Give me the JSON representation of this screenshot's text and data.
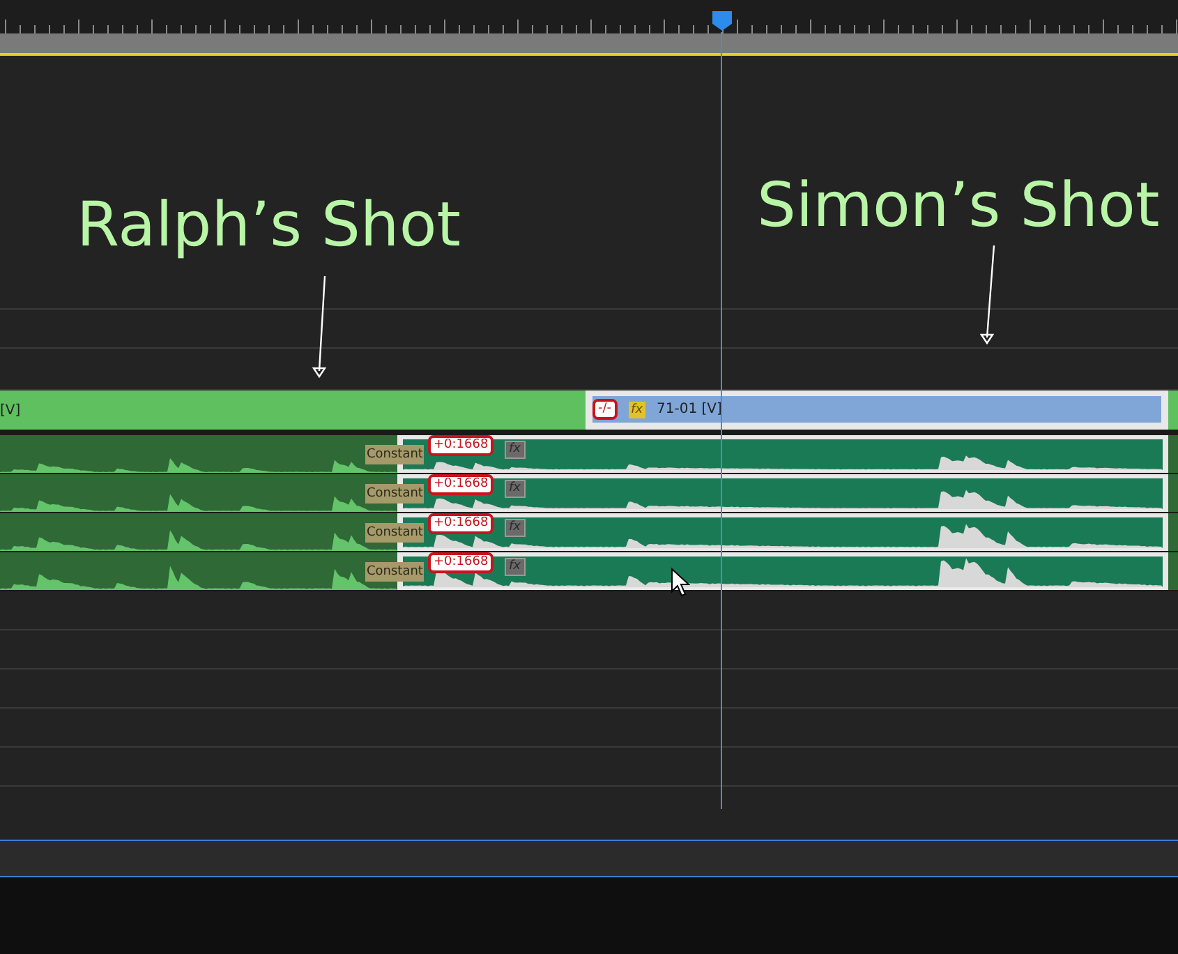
{
  "annotations": [
    {
      "text": "Ralph’s Shot"
    },
    {
      "text": "Simon’s Shot"
    }
  ],
  "video_track": {
    "clips": [
      {
        "label": "[V]",
        "selected": false
      },
      {
        "label": "71-01 [V]",
        "selected": true,
        "badge": "-/-",
        "fx": "fx"
      }
    ]
  },
  "audio_tracks": [
    {
      "left_clip": {
        "selected": false,
        "keyframe_label": "Constant"
      },
      "right_clip": {
        "selected": true,
        "badge": "+0:1668",
        "fx": "fx"
      }
    },
    {
      "left_clip": {
        "selected": false,
        "keyframe_label": "Constant"
      },
      "right_clip": {
        "selected": true,
        "badge": "+0:1668",
        "fx": "fx"
      }
    },
    {
      "left_clip": {
        "selected": false,
        "keyframe_label": "Constant"
      },
      "right_clip": {
        "selected": true,
        "badge": "+0:1668",
        "fx": "fx"
      }
    },
    {
      "left_clip": {
        "selected": false,
        "keyframe_label": "Constant"
      },
      "right_clip": {
        "selected": true,
        "badge": "+0:1668",
        "fx": "fx"
      }
    }
  ]
}
